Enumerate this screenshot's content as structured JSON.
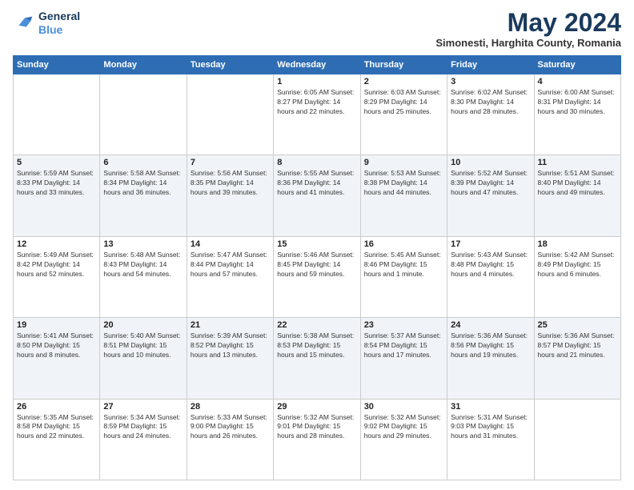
{
  "header": {
    "logo_line1": "General",
    "logo_line2": "Blue",
    "month": "May 2024",
    "location": "Simonesti, Harghita County, Romania"
  },
  "weekdays": [
    "Sunday",
    "Monday",
    "Tuesday",
    "Wednesday",
    "Thursday",
    "Friday",
    "Saturday"
  ],
  "weeks": [
    [
      {
        "day": "",
        "text": ""
      },
      {
        "day": "",
        "text": ""
      },
      {
        "day": "",
        "text": ""
      },
      {
        "day": "1",
        "text": "Sunrise: 6:05 AM\nSunset: 8:27 PM\nDaylight: 14 hours\nand 22 minutes."
      },
      {
        "day": "2",
        "text": "Sunrise: 6:03 AM\nSunset: 8:29 PM\nDaylight: 14 hours\nand 25 minutes."
      },
      {
        "day": "3",
        "text": "Sunrise: 6:02 AM\nSunset: 8:30 PM\nDaylight: 14 hours\nand 28 minutes."
      },
      {
        "day": "4",
        "text": "Sunrise: 6:00 AM\nSunset: 8:31 PM\nDaylight: 14 hours\nand 30 minutes."
      }
    ],
    [
      {
        "day": "5",
        "text": "Sunrise: 5:59 AM\nSunset: 8:33 PM\nDaylight: 14 hours\nand 33 minutes."
      },
      {
        "day": "6",
        "text": "Sunrise: 5:58 AM\nSunset: 8:34 PM\nDaylight: 14 hours\nand 36 minutes."
      },
      {
        "day": "7",
        "text": "Sunrise: 5:56 AM\nSunset: 8:35 PM\nDaylight: 14 hours\nand 39 minutes."
      },
      {
        "day": "8",
        "text": "Sunrise: 5:55 AM\nSunset: 8:36 PM\nDaylight: 14 hours\nand 41 minutes."
      },
      {
        "day": "9",
        "text": "Sunrise: 5:53 AM\nSunset: 8:38 PM\nDaylight: 14 hours\nand 44 minutes."
      },
      {
        "day": "10",
        "text": "Sunrise: 5:52 AM\nSunset: 8:39 PM\nDaylight: 14 hours\nand 47 minutes."
      },
      {
        "day": "11",
        "text": "Sunrise: 5:51 AM\nSunset: 8:40 PM\nDaylight: 14 hours\nand 49 minutes."
      }
    ],
    [
      {
        "day": "12",
        "text": "Sunrise: 5:49 AM\nSunset: 8:42 PM\nDaylight: 14 hours\nand 52 minutes."
      },
      {
        "day": "13",
        "text": "Sunrise: 5:48 AM\nSunset: 8:43 PM\nDaylight: 14 hours\nand 54 minutes."
      },
      {
        "day": "14",
        "text": "Sunrise: 5:47 AM\nSunset: 8:44 PM\nDaylight: 14 hours\nand 57 minutes."
      },
      {
        "day": "15",
        "text": "Sunrise: 5:46 AM\nSunset: 8:45 PM\nDaylight: 14 hours\nand 59 minutes."
      },
      {
        "day": "16",
        "text": "Sunrise: 5:45 AM\nSunset: 8:46 PM\nDaylight: 15 hours\nand 1 minute."
      },
      {
        "day": "17",
        "text": "Sunrise: 5:43 AM\nSunset: 8:48 PM\nDaylight: 15 hours\nand 4 minutes."
      },
      {
        "day": "18",
        "text": "Sunrise: 5:42 AM\nSunset: 8:49 PM\nDaylight: 15 hours\nand 6 minutes."
      }
    ],
    [
      {
        "day": "19",
        "text": "Sunrise: 5:41 AM\nSunset: 8:50 PM\nDaylight: 15 hours\nand 8 minutes."
      },
      {
        "day": "20",
        "text": "Sunrise: 5:40 AM\nSunset: 8:51 PM\nDaylight: 15 hours\nand 10 minutes."
      },
      {
        "day": "21",
        "text": "Sunrise: 5:39 AM\nSunset: 8:52 PM\nDaylight: 15 hours\nand 13 minutes."
      },
      {
        "day": "22",
        "text": "Sunrise: 5:38 AM\nSunset: 8:53 PM\nDaylight: 15 hours\nand 15 minutes."
      },
      {
        "day": "23",
        "text": "Sunrise: 5:37 AM\nSunset: 8:54 PM\nDaylight: 15 hours\nand 17 minutes."
      },
      {
        "day": "24",
        "text": "Sunrise: 5:36 AM\nSunset: 8:56 PM\nDaylight: 15 hours\nand 19 minutes."
      },
      {
        "day": "25",
        "text": "Sunrise: 5:36 AM\nSunset: 8:57 PM\nDaylight: 15 hours\nand 21 minutes."
      }
    ],
    [
      {
        "day": "26",
        "text": "Sunrise: 5:35 AM\nSunset: 8:58 PM\nDaylight: 15 hours\nand 22 minutes."
      },
      {
        "day": "27",
        "text": "Sunrise: 5:34 AM\nSunset: 8:59 PM\nDaylight: 15 hours\nand 24 minutes."
      },
      {
        "day": "28",
        "text": "Sunrise: 5:33 AM\nSunset: 9:00 PM\nDaylight: 15 hours\nand 26 minutes."
      },
      {
        "day": "29",
        "text": "Sunrise: 5:32 AM\nSunset: 9:01 PM\nDaylight: 15 hours\nand 28 minutes."
      },
      {
        "day": "30",
        "text": "Sunrise: 5:32 AM\nSunset: 9:02 PM\nDaylight: 15 hours\nand 29 minutes."
      },
      {
        "day": "31",
        "text": "Sunrise: 5:31 AM\nSunset: 9:03 PM\nDaylight: 15 hours\nand 31 minutes."
      },
      {
        "day": "",
        "text": ""
      }
    ]
  ]
}
